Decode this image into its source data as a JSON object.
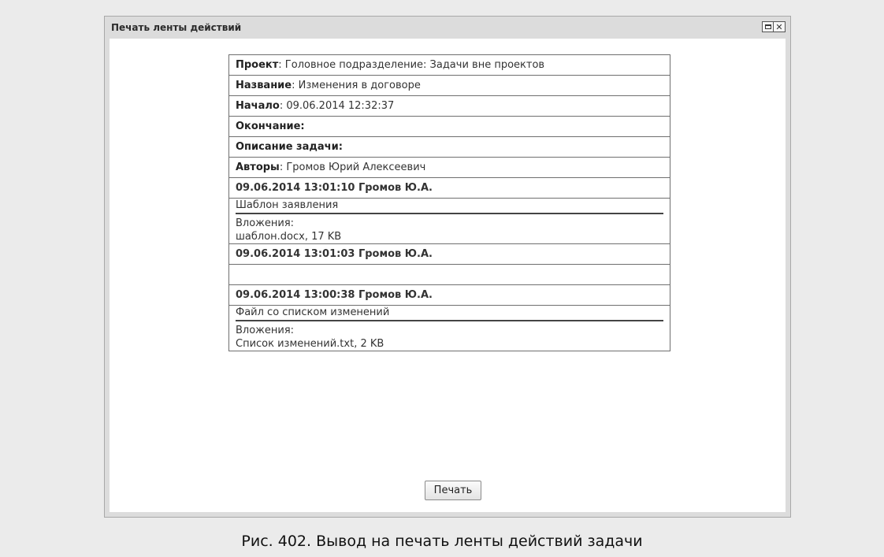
{
  "window": {
    "title": "Печать ленты действий",
    "restore_icon": "restore-window-icon",
    "close_icon": "close-icon",
    "close_glyph": "✕"
  },
  "task": {
    "project_label": "Проект",
    "project_value": ": Головное подразделение: Задачи вне проектов",
    "name_label": "Название",
    "name_value": ": Изменения в договоре",
    "start_label": "Начало",
    "start_value": ": 09.06.2014 12:32:37",
    "end_label": "Окончание",
    "end_value": ":",
    "description_label": "Описание задачи",
    "description_value": ":",
    "authors_label": "Авторы",
    "authors_value": ": Громов Юрий Алексеевич"
  },
  "entries": [
    {
      "header": "09.06.2014 13:01:10 Громов Ю.А.",
      "subject": "Шаблон заявления",
      "attachments_label": "Вложения:",
      "attachment": "шаблон.docx, 17 KB"
    },
    {
      "header": "09.06.2014 13:01:03 Громов Ю.А."
    },
    {
      "header": "09.06.2014 13:00:38 Громов Ю.А.",
      "subject": "Файл со списком изменений",
      "attachments_label": "Вложения:",
      "attachment": "Список изменений.txt, 2 KB"
    }
  ],
  "print_button": "Печать",
  "caption": "Рис. 402. Вывод на печать ленты действий задачи"
}
